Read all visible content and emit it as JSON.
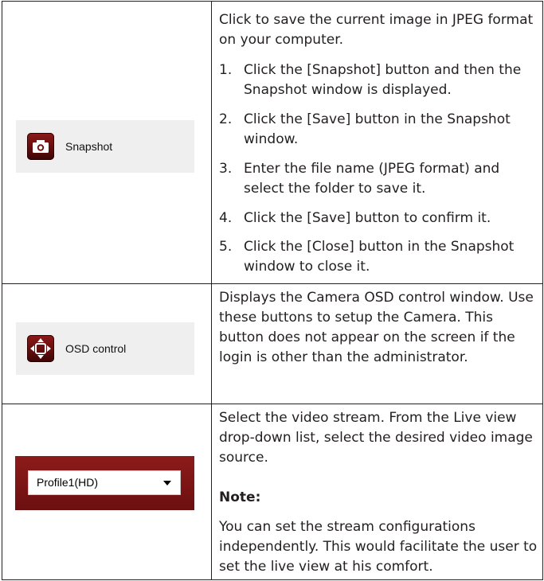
{
  "rows": [
    {
      "button": {
        "label": "Snapshot",
        "icon": "camera-icon"
      },
      "intro": "Click to save the current image in JPEG format on your computer.",
      "steps": [
        {
          "num": "1.",
          "text": "Click the [Snapshot] button and then the Snapshot window is displayed."
        },
        {
          "num": "2.",
          "text": "Click the [Save] button in the Snapshot window."
        },
        {
          "num": "3.",
          "text": "Enter the file name (JPEG format) and select the folder to save it."
        },
        {
          "num": "4.",
          "text": "Click the [Save] button to confirm it."
        },
        {
          "num": "5.",
          "text": "Click the [Close] button in the Snapshot window to close it."
        }
      ]
    },
    {
      "button": {
        "label": "OSD control",
        "icon": "osd-direction-icon"
      },
      "description": "Displays the Camera OSD control window. Use these buttons to setup the Camera. This button does not appear on the screen if the login is other than the administrator."
    },
    {
      "select": {
        "value": "Profile1(HD)",
        "icon": "dropdown-arrow-icon"
      },
      "description": "Select the video stream. From the Live view drop-down list, select the desired video image source.",
      "note_heading": "Note:",
      "note_text": "You can set the stream configurations independently. This would facilitate the user to set the live view at his comfort."
    }
  ],
  "colors": {
    "button_red": "#7a1414",
    "panel_gray": "#efefef",
    "border": "#231f20"
  }
}
